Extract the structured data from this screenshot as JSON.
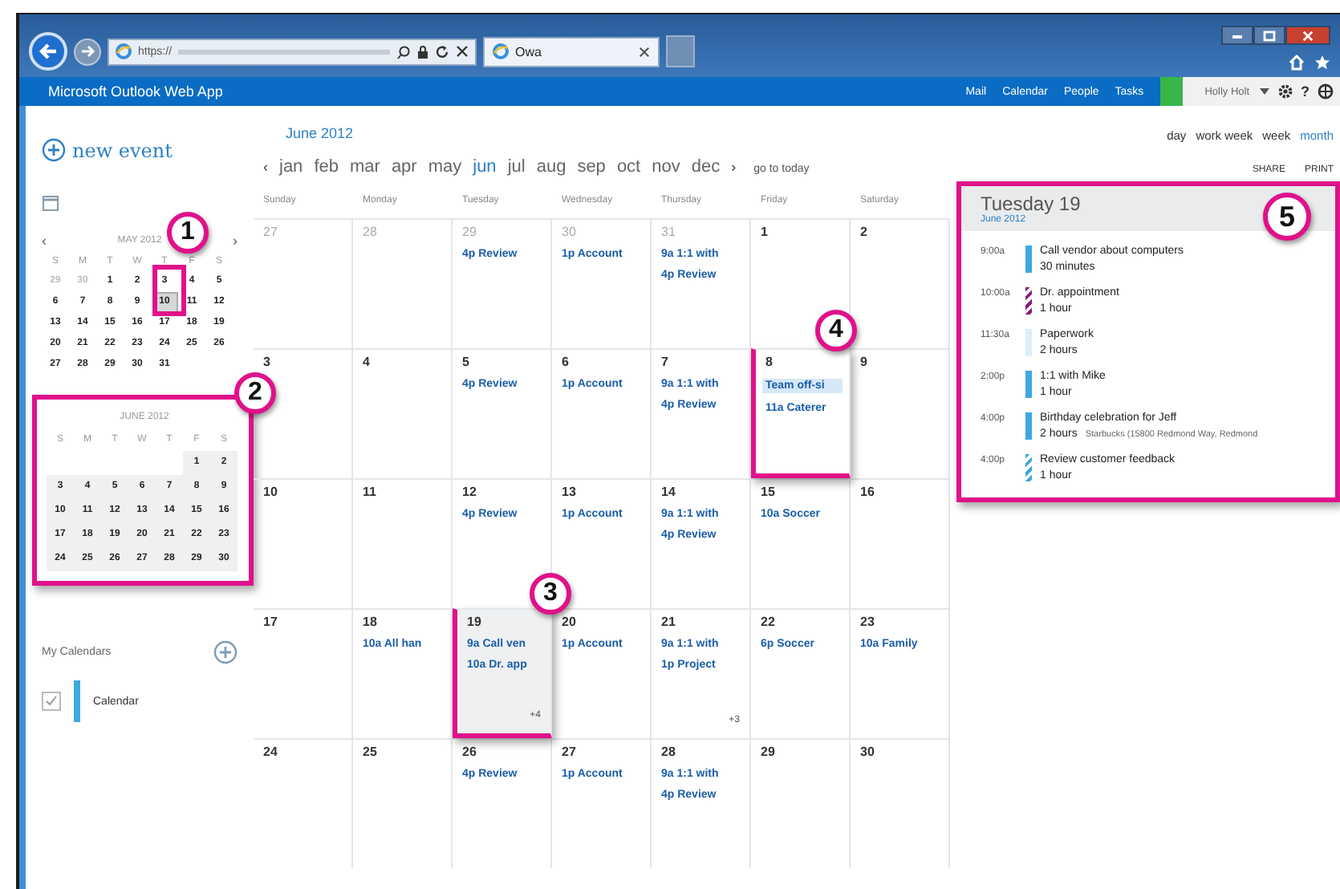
{
  "browser": {
    "address": "https://",
    "tab": {
      "title": "Owa"
    }
  },
  "app_bar": {
    "title": "Microsoft Outlook Web App",
    "nav": [
      {
        "label": "Mail"
      },
      {
        "label": "Calendar"
      },
      {
        "label": "People"
      },
      {
        "label": "Tasks"
      }
    ],
    "user": "Holly Holt",
    "help": "?"
  },
  "sidebar": {
    "new_event": "new event",
    "mini_may": {
      "title": "MAY 2012",
      "prev": "‹",
      "next": "›",
      "callout": "1",
      "weekdays": [
        "S",
        "M",
        "T",
        "W",
        "T",
        "F",
        "S"
      ],
      "weeks": [
        [
          {
            "d": "29",
            "muted": true,
            "selected": false
          },
          {
            "d": "30",
            "muted": true,
            "selected": false
          },
          {
            "d": "1",
            "muted": false,
            "selected": false
          },
          {
            "d": "2",
            "muted": false,
            "selected": false
          },
          {
            "d": "3",
            "muted": false,
            "selected": false
          },
          {
            "d": "4",
            "muted": false,
            "selected": false
          },
          {
            "d": "5",
            "muted": false,
            "selected": false
          }
        ],
        [
          {
            "d": "6",
            "muted": false,
            "selected": false
          },
          {
            "d": "7",
            "muted": false,
            "selected": false
          },
          {
            "d": "8",
            "muted": false,
            "selected": false
          },
          {
            "d": "9",
            "muted": false,
            "selected": false
          },
          {
            "d": "10",
            "muted": false,
            "selected": true
          },
          {
            "d": "11",
            "muted": false,
            "selected": false
          },
          {
            "d": "12",
            "muted": false,
            "selected": false
          }
        ],
        [
          {
            "d": "13",
            "muted": false,
            "selected": false
          },
          {
            "d": "14",
            "muted": false,
            "selected": false
          },
          {
            "d": "15",
            "muted": false,
            "selected": false
          },
          {
            "d": "16",
            "muted": false,
            "selected": false
          },
          {
            "d": "17",
            "muted": false,
            "selected": false
          },
          {
            "d": "18",
            "muted": false,
            "selected": false
          },
          {
            "d": "19",
            "muted": false,
            "selected": false
          }
        ],
        [
          {
            "d": "20",
            "muted": false,
            "selected": false
          },
          {
            "d": "21",
            "muted": false,
            "selected": false
          },
          {
            "d": "22",
            "muted": false,
            "selected": false
          },
          {
            "d": "23",
            "muted": false,
            "selected": false
          },
          {
            "d": "24",
            "muted": false,
            "selected": false
          },
          {
            "d": "25",
            "muted": false,
            "selected": false
          },
          {
            "d": "26",
            "muted": false,
            "selected": false
          }
        ],
        [
          {
            "d": "27",
            "muted": false,
            "selected": false
          },
          {
            "d": "28",
            "muted": false,
            "selected": false
          },
          {
            "d": "29",
            "muted": false,
            "selected": false
          },
          {
            "d": "30",
            "muted": false,
            "selected": false
          },
          {
            "d": "31",
            "muted": false,
            "selected": false
          }
        ]
      ]
    },
    "mini_june": {
      "title": "JUNE 2012",
      "callout": "2",
      "weekdays": [
        "S",
        "M",
        "T",
        "W",
        "T",
        "F",
        "S"
      ],
      "weeks": [
        [
          "1",
          "2"
        ],
        [
          "3",
          "4",
          "5",
          "6",
          "7",
          "8",
          "9"
        ],
        [
          "10",
          "11",
          "12",
          "13",
          "14",
          "15",
          "16"
        ],
        [
          "17",
          "18",
          "19",
          "20",
          "21",
          "22",
          "23"
        ],
        [
          "24",
          "25",
          "26",
          "27",
          "28",
          "29",
          "30"
        ]
      ]
    },
    "my_calendars": {
      "title": "My Calendars",
      "items": [
        {
          "name": "Calendar",
          "checked": true,
          "color": "#3ea8e0"
        }
      ]
    }
  },
  "calendar": {
    "title": "June 2012",
    "prev": "‹",
    "next": "›",
    "go_to_today": "go to today",
    "months": [
      {
        "label": "jan",
        "selected": false
      },
      {
        "label": "feb",
        "selected": false
      },
      {
        "label": "mar",
        "selected": false
      },
      {
        "label": "apr",
        "selected": false
      },
      {
        "label": "may",
        "selected": false
      },
      {
        "label": "jun",
        "selected": true
      },
      {
        "label": "jul",
        "selected": false
      },
      {
        "label": "aug",
        "selected": false
      },
      {
        "label": "sep",
        "selected": false
      },
      {
        "label": "oct",
        "selected": false
      },
      {
        "label": "nov",
        "selected": false
      },
      {
        "label": "dec",
        "selected": false
      }
    ],
    "views": [
      {
        "label": "day",
        "selected": false
      },
      {
        "label": "work week",
        "selected": false
      },
      {
        "label": "week",
        "selected": false
      },
      {
        "label": "month",
        "selected": true
      }
    ],
    "actions": [
      "SHARE",
      "PRINT"
    ],
    "weekdays": [
      "Sunday",
      "Monday",
      "Tuesday",
      "Wednesday",
      "Thursday",
      "Friday",
      "Saturday"
    ],
    "weeks": [
      [
        {
          "day": "27",
          "other_month": true,
          "selected": false
        },
        {
          "day": "28",
          "other_month": true,
          "selected": false
        },
        {
          "day": "29",
          "other_month": true,
          "selected": false,
          "events": [
            {
              "text": "4p Review",
              "all_day": false
            }
          ]
        },
        {
          "day": "30",
          "other_month": true,
          "selected": false,
          "events": [
            {
              "text": "1p Account",
              "all_day": false
            }
          ]
        },
        {
          "day": "31",
          "other_month": true,
          "selected": false,
          "events": [
            {
              "text": "9a 1:1 with",
              "all_day": false
            },
            {
              "text": "4p Review",
              "all_day": false
            }
          ]
        },
        {
          "day": "1",
          "other_month": false,
          "selected": false
        },
        {
          "day": "2",
          "other_month": false,
          "selected": false
        }
      ],
      [
        {
          "day": "3",
          "other_month": false,
          "selected": false
        },
        {
          "day": "4",
          "other_month": false,
          "selected": false
        },
        {
          "day": "5",
          "other_month": false,
          "selected": false,
          "events": [
            {
              "text": "4p Review",
              "all_day": false
            }
          ]
        },
        {
          "day": "6",
          "other_month": false,
          "selected": false,
          "events": [
            {
              "text": "1p Account",
              "all_day": false
            }
          ]
        },
        {
          "day": "7",
          "other_month": false,
          "selected": false,
          "events": [
            {
              "text": "9a 1:1 with",
              "all_day": false
            },
            {
              "text": "4p Review",
              "all_day": false
            }
          ]
        },
        {
          "day": "8",
          "other_month": false,
          "selected": false,
          "callout": "4",
          "events": [
            {
              "text": "Team off-si",
              "all_day": true
            },
            {
              "text": "11a Caterer",
              "all_day": false
            }
          ]
        },
        {
          "day": "9",
          "other_month": false,
          "selected": false
        }
      ],
      [
        {
          "day": "10",
          "other_month": false,
          "selected": false
        },
        {
          "day": "11",
          "other_month": false,
          "selected": false
        },
        {
          "day": "12",
          "other_month": false,
          "selected": false,
          "events": [
            {
              "text": "4p Review",
              "all_day": false
            }
          ]
        },
        {
          "day": "13",
          "other_month": false,
          "selected": false,
          "events": [
            {
              "text": "1p Account",
              "all_day": false
            }
          ]
        },
        {
          "day": "14",
          "other_month": false,
          "selected": false,
          "events": [
            {
              "text": "9a 1:1 with",
              "all_day": false
            },
            {
              "text": "4p Review",
              "all_day": false
            }
          ]
        },
        {
          "day": "15",
          "other_month": false,
          "selected": false,
          "events": [
            {
              "text": "10a Soccer",
              "all_day": false
            }
          ]
        },
        {
          "day": "16",
          "other_month": false,
          "selected": false
        }
      ],
      [
        {
          "day": "17",
          "other_month": false,
          "selected": false
        },
        {
          "day": "18",
          "other_month": false,
          "selected": false,
          "events": [
            {
              "text": "10a All han",
              "all_day": false
            }
          ]
        },
        {
          "day": "19",
          "other_month": false,
          "selected": true,
          "callout": "3",
          "events": [
            {
              "text": "9a Call ven",
              "all_day": false
            },
            {
              "text": "10a Dr. app",
              "all_day": false
            }
          ],
          "more": "+4"
        },
        {
          "day": "20",
          "other_month": false,
          "selected": false,
          "events": [
            {
              "text": "1p Account",
              "all_day": false
            }
          ]
        },
        {
          "day": "21",
          "other_month": false,
          "selected": false,
          "events": [
            {
              "text": "9a 1:1 with",
              "all_day": false
            },
            {
              "text": "1p Project",
              "all_day": false
            }
          ],
          "more": "+3"
        },
        {
          "day": "22",
          "other_month": false,
          "selected": false,
          "events": [
            {
              "text": "6p Soccer",
              "all_day": false
            }
          ]
        },
        {
          "day": "23",
          "other_month": false,
          "selected": false,
          "events": [
            {
              "text": "10a Family",
              "all_day": false
            }
          ]
        }
      ],
      [
        {
          "day": "24",
          "other_month": false,
          "selected": false
        },
        {
          "day": "25",
          "other_month": false,
          "selected": false
        },
        {
          "day": "26",
          "other_month": false,
          "selected": false,
          "events": [
            {
              "text": "4p Review",
              "all_day": false
            }
          ]
        },
        {
          "day": "27",
          "other_month": false,
          "selected": false,
          "events": [
            {
              "text": "1p Account",
              "all_day": false
            }
          ]
        },
        {
          "day": "28",
          "other_month": false,
          "selected": false,
          "events": [
            {
              "text": "9a 1:1 with",
              "all_day": false
            },
            {
              "text": "4p Review",
              "all_day": false
            }
          ]
        },
        {
          "day": "29",
          "other_month": false,
          "selected": false
        },
        {
          "day": "30",
          "other_month": false,
          "selected": false
        }
      ]
    ]
  },
  "day_panel": {
    "title": "Tuesday 19",
    "subtitle": "June 2012",
    "callout": "5",
    "events": [
      {
        "time": "9:00a",
        "title": "Call vendor about computers",
        "duration": "30 minutes",
        "kind": "solid",
        "color": "#3ea8e0"
      },
      {
        "time": "10:00a",
        "title": "Dr. appointment",
        "duration": "1 hour",
        "kind": "striped",
        "color": "#8a1b7e"
      },
      {
        "time": "11:30a",
        "title": "Paperwork",
        "duration": "2 hours",
        "kind": "solid",
        "color": "#dceef9"
      },
      {
        "time": "2:00p",
        "title": "1:1 with Mike",
        "duration": "1 hour",
        "kind": "solid",
        "color": "#3ea8e0"
      },
      {
        "time": "4:00p",
        "title": "Birthday celebration for Jeff",
        "duration": "2 hours",
        "location": "Starbucks (15800 Redmond Way, Redmond",
        "kind": "solid",
        "color": "#3ea8e0"
      },
      {
        "time": "4:00p",
        "title": "Review customer feedback",
        "duration": "1 hour",
        "kind": "striped",
        "color": "#3ea8e0"
      }
    ]
  }
}
